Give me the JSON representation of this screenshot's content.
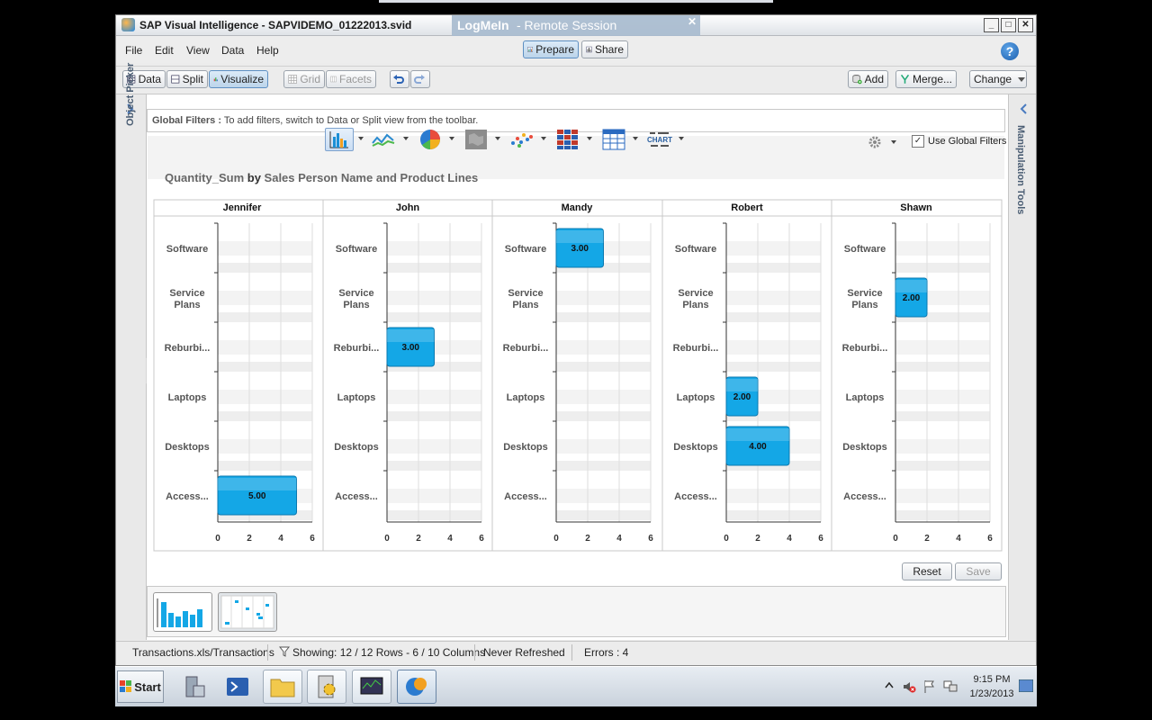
{
  "window": {
    "title": "SAP Visual Intelligence  - SAPVIDEMO_01222013.svid",
    "logmein_brand": "LogMeIn",
    "logmein_label": "- Remote Session"
  },
  "menu": [
    "File",
    "Edit",
    "View",
    "Data",
    "Help"
  ],
  "modes": {
    "prepare": "Prepare",
    "share": "Share"
  },
  "view_tabs": {
    "data": "Data",
    "split": "Split",
    "visualize": "Visualize"
  },
  "view_opts": {
    "grid": "Grid",
    "facets": "Facets"
  },
  "right_actions": {
    "add": "Add",
    "merge": "Merge...",
    "change": "Change"
  },
  "side_panels": {
    "left": "Object Picker",
    "right": "Manipulation Tools"
  },
  "global_filters": {
    "label": "Global Filters :",
    "text": "To add filters, switch to Data or Split view from the toolbar."
  },
  "chart_toolbar": {
    "use_global_filters": "Use Global Filters",
    "use_global_checked": true
  },
  "chart_buttons": [
    "bar-chart-icon",
    "line-chart-icon",
    "pie-chart-icon",
    "geo-map-icon",
    "scatter-icon",
    "heatmap-icon",
    "table-chart-icon",
    "word-cloud-icon"
  ],
  "word_cloud_label": "CHART",
  "chart_data": {
    "type": "bar",
    "orientation": "horizontal",
    "title_measure": "Quantity_Sum",
    "title_by": "by",
    "title_dims": "Sales Person Name and Product Lines",
    "panels": [
      "Jennifer",
      "John",
      "Mandy",
      "Robert",
      "Shawn"
    ],
    "categories": [
      "Software",
      "Service Plans",
      "Reburbi...",
      "Laptops",
      "Desktops",
      "Access..."
    ],
    "category_lines": [
      [
        "Software"
      ],
      [
        "Service",
        "Plans"
      ],
      [
        "Reburbi..."
      ],
      [
        "Laptops"
      ],
      [
        "Desktops"
      ],
      [
        "Access..."
      ]
    ],
    "values": {
      "Jennifer": [
        null,
        null,
        null,
        null,
        null,
        5
      ],
      "John": [
        null,
        null,
        3,
        null,
        null,
        null
      ],
      "Mandy": [
        3,
        null,
        null,
        null,
        null,
        null
      ],
      "Robert": [
        null,
        null,
        null,
        2,
        4,
        null
      ],
      "Shawn": [
        null,
        2,
        null,
        null,
        null,
        null
      ]
    },
    "value_labels": {
      "Jennifer": [
        null,
        null,
        null,
        null,
        null,
        "5.00"
      ],
      "John": [
        null,
        null,
        "3.00",
        null,
        null,
        null
      ],
      "Mandy": [
        "3.00",
        null,
        null,
        null,
        null,
        null
      ],
      "Robert": [
        null,
        null,
        null,
        "2.00",
        "4.00",
        null
      ],
      "Shawn": [
        null,
        "2.00",
        null,
        null,
        null,
        null
      ]
    },
    "xlim": [
      0,
      6
    ],
    "xticks": [
      "0",
      "2",
      "4",
      "6"
    ],
    "grid": true,
    "bar_color": "#14a7e6"
  },
  "chart_actions": {
    "reset": "Reset",
    "save": "Save"
  },
  "status": {
    "source": "Transactions.xls/Transactions",
    "showing": "Showing:  12 / 12 Rows - 6 / 10 Columns",
    "refresh": "Never Refreshed",
    "errors": "Errors : 4"
  },
  "taskbar": {
    "start": "Start",
    "time": "9:15 PM",
    "date": "1/23/2013"
  }
}
